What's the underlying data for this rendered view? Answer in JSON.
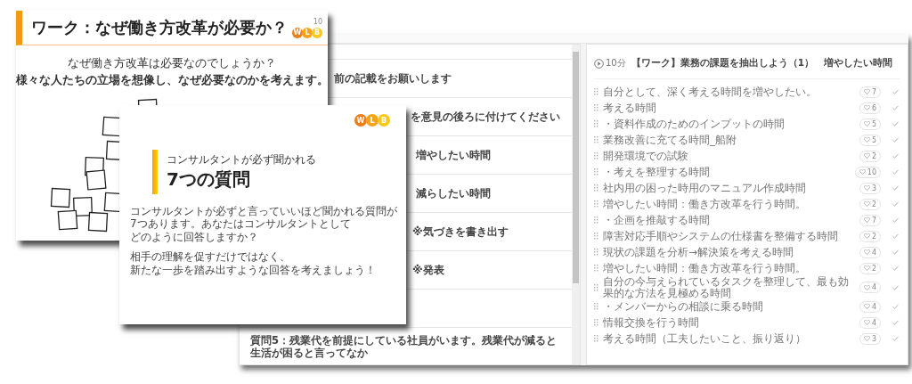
{
  "board": {
    "rows": [
      {
        "text": "前の記載をお願いします"
      },
      {
        "text": "を意見の後ろに付けてください"
      },
      {
        "text": "増やしたい時間"
      },
      {
        "text": "減らしたい時間"
      },
      {
        "text": "※気づきを書き出す"
      },
      {
        "text": "※発表"
      },
      {
        "text": ""
      },
      {
        "text": "質問5：残業代を前提にしている社員がいます。残業代が減ると生活が困ると言ってなか"
      }
    ]
  },
  "card": {
    "duration": "10分",
    "title": "【ワーク】業務の課題を抽出しよう（1）　増やしたい時間",
    "ideas": [
      {
        "text": "自分として、深く考える時間を増やしたい。",
        "likes": "7"
      },
      {
        "text": "考える時間",
        "likes": "6"
      },
      {
        "text": "・資料作成のためのインプットの時間",
        "likes": "5"
      },
      {
        "text": "業務改善に充てる時間_船附",
        "likes": "5"
      },
      {
        "text": "開発環境での試験",
        "likes": "2"
      },
      {
        "text": "・考えを整理する時間",
        "likes": "10"
      },
      {
        "text": "社内用の困った時用のマニュアル作成時間",
        "likes": "3"
      },
      {
        "text": "増やしたい時間：働き方改革を行う時間。",
        "likes": "2"
      },
      {
        "text": "・企画を推敲する時間",
        "likes": "7"
      },
      {
        "text": "障害対応手順やシステムの仕様書を整備する時間",
        "likes": "2"
      },
      {
        "text": "現状の課題を分析→解決策を考える時間",
        "likes": "4"
      },
      {
        "text": "増やしたい時間：働き方改革を行う時間。",
        "likes": "2"
      },
      {
        "text": "自分の今与えられているタスクを整理して、最も効果的な方法を見極める時間",
        "likes": "4"
      },
      {
        "text": "・メンバーからの相談に乗る時間",
        "likes": "4"
      },
      {
        "text": "情報交換を行う時間",
        "likes": "4"
      },
      {
        "text": "考える時間（工夫したいこと、振り返り）",
        "likes": "3"
      }
    ]
  },
  "slides": [
    {
      "kind": "work",
      "page": "10",
      "title": "ワーク：なぜ働き方改革が必要か？",
      "logo": [
        "W",
        "L",
        "B"
      ],
      "question": "なぜ働き方改革は必要なのでしょうか？",
      "instruction": "様々な人たちの立場を想像し、なぜ必要なのかを考えます。"
    },
    {
      "kind": "cover",
      "logo": [
        "W",
        "L",
        "B"
      ],
      "subtitle": "コンサルタントが必ず聞かれる",
      "title": "7つの質問",
      "paragraphs": [
        [
          "コンサルタントが必ずと言っていいほど聞かれる質問が",
          "7つあります。あなたはコンサルタントとして",
          "どのように回答しますか？"
        ],
        [
          "相手の理解を促すだけではなく、",
          "新たな一歩を踏み出すような回答を考えましょう！"
        ]
      ]
    }
  ]
}
